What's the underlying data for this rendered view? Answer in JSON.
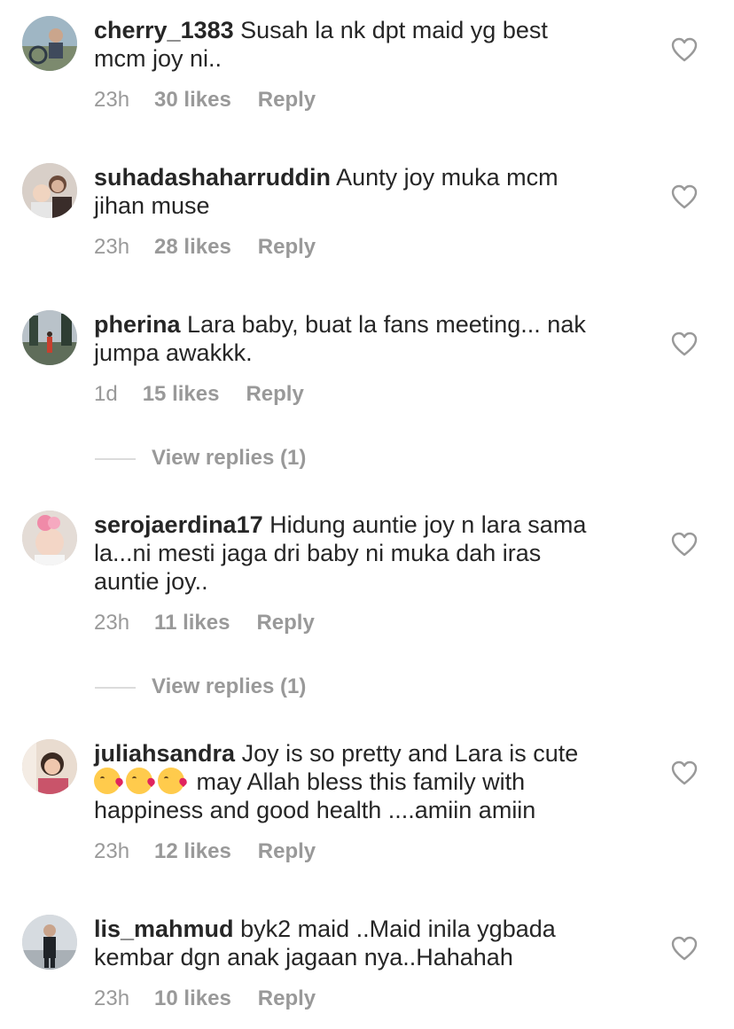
{
  "comments": [
    {
      "username": "cherry_1383",
      "text": "Susah la nk dpt maid yg best\nmcm joy ni..",
      "time": "23h",
      "likes": "30 likes",
      "reply": "Reply"
    },
    {
      "username": "suhadashaharruddin",
      "text": "Aunty joy muka mcm\njihan muse",
      "time": "23h",
      "likes": "28 likes",
      "reply": "Reply"
    },
    {
      "username": "pherina",
      "text": "Lara baby, buat la fans meeting... nak\njumpa awakkk.",
      "time": "1d",
      "likes": "15 likes",
      "reply": "Reply",
      "view_replies": "View replies (1)"
    },
    {
      "username": "serojaerdina17",
      "text": "Hidung auntie joy n lara sama\nla...ni mesti jaga dri baby ni muka dah iras\nauntie joy..",
      "time": "23h",
      "likes": "11 likes",
      "reply": "Reply",
      "view_replies": "View replies (1)"
    },
    {
      "username": "juliahsandra",
      "text_before": "Joy is so pretty and Lara is cute",
      "text_after": " may Allah bless this family with\nhappiness and good health ....amiin amiin",
      "emojis": [
        "kissing-heart-emoji",
        "kissing-heart-emoji",
        "kissing-heart-emoji"
      ],
      "time": "23h",
      "likes": "12 likes",
      "reply": "Reply"
    },
    {
      "username": "lis_mahmud",
      "text": "byk2 maid ..Maid inila ygbada\nkembar dgn anak jagaan nya..Hahahah",
      "time": "23h",
      "likes": "10 likes",
      "reply": "Reply"
    }
  ],
  "icons": {
    "like": "heart-outline-icon"
  },
  "colors": {
    "text": "#262626",
    "meta": "#999999",
    "divider": "#dbdbdb"
  }
}
